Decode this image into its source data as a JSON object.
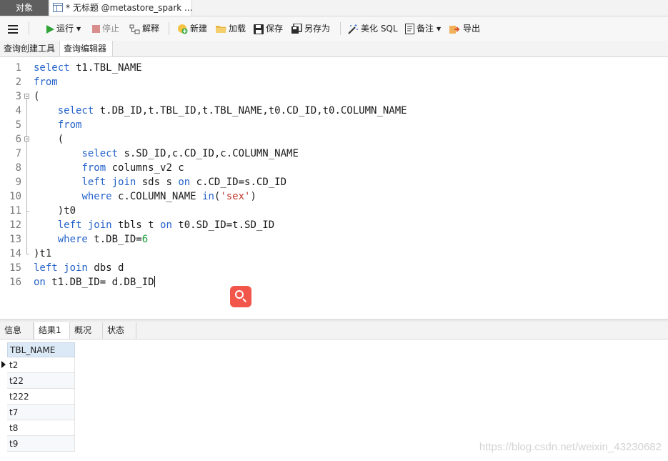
{
  "tabs": {
    "objects": "对象",
    "query_tab": "* 无标题 @metastore_spark ..."
  },
  "toolbar": {
    "run": "运行",
    "stop": "停止",
    "explain": "解释",
    "new": "新建",
    "load": "加载",
    "save": "保存",
    "save_as": "另存为",
    "beautify": "美化 SQL",
    "comment": "备注",
    "export": "导出"
  },
  "subtabs": {
    "builder": "查询创建工具",
    "editor": "查询编辑器"
  },
  "editor": {
    "line_numbers": [
      "1",
      "2",
      "3",
      "4",
      "5",
      "6",
      "7",
      "8",
      "9",
      "10",
      "11",
      "12",
      "13",
      "14",
      "15",
      "16"
    ]
  },
  "result_tabs": {
    "info": "信息",
    "result1": "结果1",
    "overview": "概况",
    "status": "状态"
  },
  "result_grid": {
    "column": "TBL_NAME",
    "rows": [
      "t2",
      "t22",
      "t222",
      "t7",
      "t8",
      "t9"
    ]
  },
  "watermark": "https://blog.csdn.net/weixin_43230682"
}
